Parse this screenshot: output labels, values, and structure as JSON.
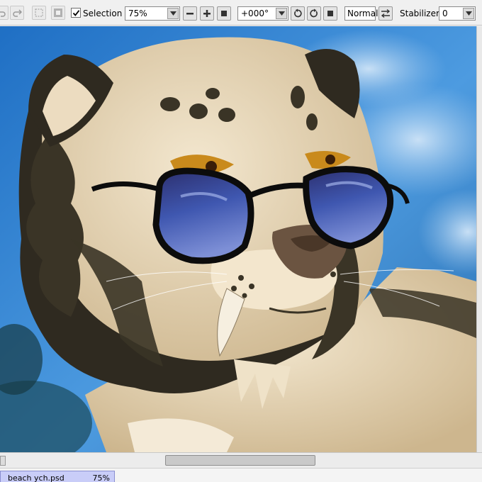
{
  "toolbar": {
    "selection_label": "Selection",
    "selection_checked": true,
    "zoom_value": "75%",
    "rotation_value": "+000°",
    "blend_mode": "Normal",
    "stabilizer_label": "Stabilizer",
    "stabilizer_value": "0"
  },
  "canvas": {
    "description_colors": {
      "sky": "#3b7fc0",
      "fur": "#e8d8bb",
      "stripes": "#3a3426",
      "lens": "#3a4a9a"
    }
  },
  "scrollbar": {
    "horizontal_position": 0.34
  },
  "document_tab": {
    "filename": "beach ych.psd",
    "zoom": "75%"
  }
}
